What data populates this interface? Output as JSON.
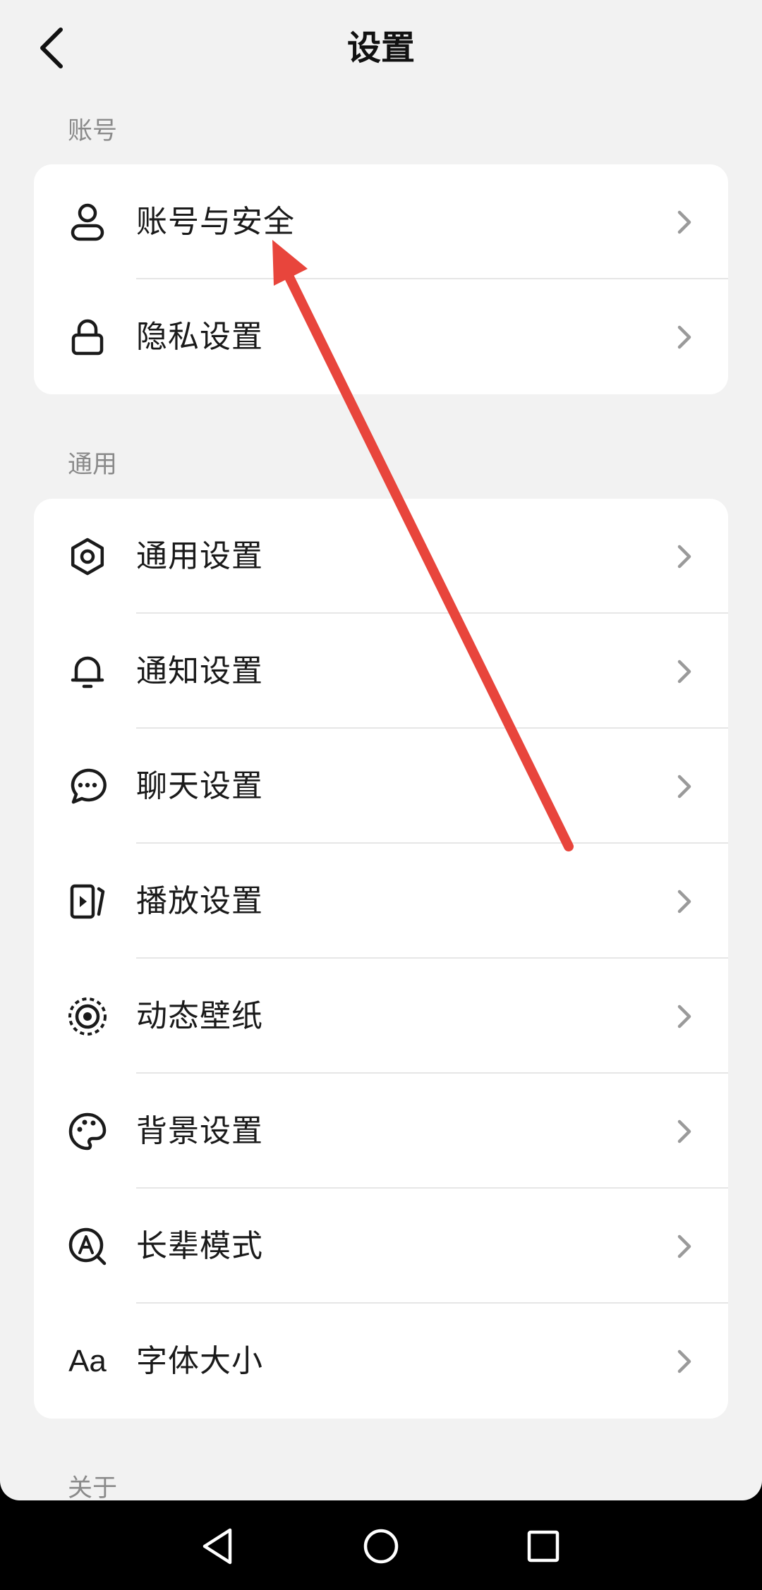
{
  "header": {
    "title": "设置",
    "back_icon": "chevron-left-icon"
  },
  "sections": [
    {
      "label": "账号",
      "items": [
        {
          "label": "账号与安全",
          "icon": "user-icon"
        },
        {
          "label": "隐私设置",
          "icon": "lock-icon"
        }
      ]
    },
    {
      "label": "通用",
      "items": [
        {
          "label": "通用设置",
          "icon": "gear-icon"
        },
        {
          "label": "通知设置",
          "icon": "bell-icon"
        },
        {
          "label": "聊天设置",
          "icon": "chat-bubble-icon"
        },
        {
          "label": "播放设置",
          "icon": "play-icon"
        },
        {
          "label": "动态壁纸",
          "icon": "live-wallpaper-icon"
        },
        {
          "label": "背景设置",
          "icon": "palette-icon"
        },
        {
          "label": "长辈模式",
          "icon": "elder-mode-icon"
        },
        {
          "label": "字体大小",
          "icon": "font-size-icon",
          "glyph": "Aa"
        }
      ]
    },
    {
      "label": "关于",
      "items": []
    }
  ],
  "annotation": {
    "type": "arrow",
    "color": "#e8453c",
    "points_to": "账号与安全"
  },
  "nav_bar": {
    "buttons": [
      "back-triangle-icon",
      "home-circle-icon",
      "recents-square-icon"
    ]
  },
  "colors": {
    "background": "#f2f2f2",
    "card": "#ffffff",
    "text": "#1a1a1a",
    "section_label": "#8a8a8a",
    "chevron": "#9a9a9a"
  }
}
